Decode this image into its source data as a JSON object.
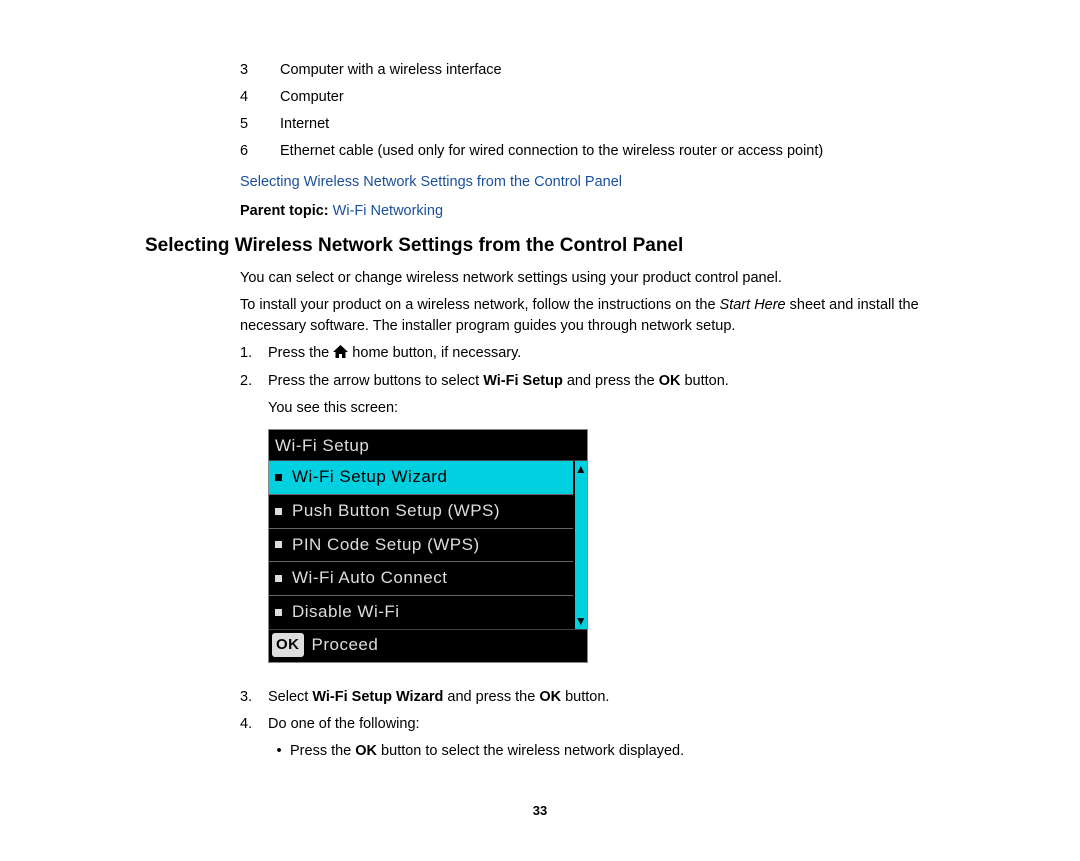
{
  "numbered_items": [
    {
      "num": "3",
      "text": "Computer with a wireless interface"
    },
    {
      "num": "4",
      "text": "Computer"
    },
    {
      "num": "5",
      "text": "Internet"
    },
    {
      "num": "6",
      "text": "Ethernet cable (used only for wired connection to the wireless router or access point)"
    }
  ],
  "link_text": "Selecting Wireless Network Settings from the Control Panel",
  "parent_topic": {
    "label": "Parent topic: ",
    "value": "Wi-Fi Networking"
  },
  "heading": "Selecting Wireless Network Settings from the Control Panel",
  "para1": "You can select or change wireless network settings using your product control panel.",
  "para2_a": "To install your product on a wireless network, follow the instructions on the ",
  "para2_b": "Start Here",
  "para2_c": " sheet and install the necessary software. The installer program guides you through network setup.",
  "steps": {
    "1": {
      "a": "Press the ",
      "b": " home button, if necessary."
    },
    "2": {
      "a": "Press the arrow buttons to select ",
      "b": "Wi-Fi Setup",
      "c": " and press the ",
      "d": "OK",
      "e": " button.",
      "sub": "You see this screen:"
    },
    "3": {
      "a": "Select ",
      "b": "Wi-Fi Setup Wizard",
      "c": " and press the ",
      "d": "OK",
      "e": " button."
    },
    "4": {
      "a": "Do one of the following:",
      "bullet_a": "Press the ",
      "bullet_b": "OK",
      "bullet_c": " button to select the wireless network displayed."
    }
  },
  "screen": {
    "title": "Wi-Fi Setup",
    "items": [
      "Wi-Fi Setup Wizard",
      "Push Button Setup (WPS)",
      "PIN Code Setup (WPS)",
      "Wi-Fi Auto Connect",
      "Disable Wi-Fi"
    ],
    "ok_label": "OK",
    "proceed": "Proceed"
  },
  "page_number": "33"
}
